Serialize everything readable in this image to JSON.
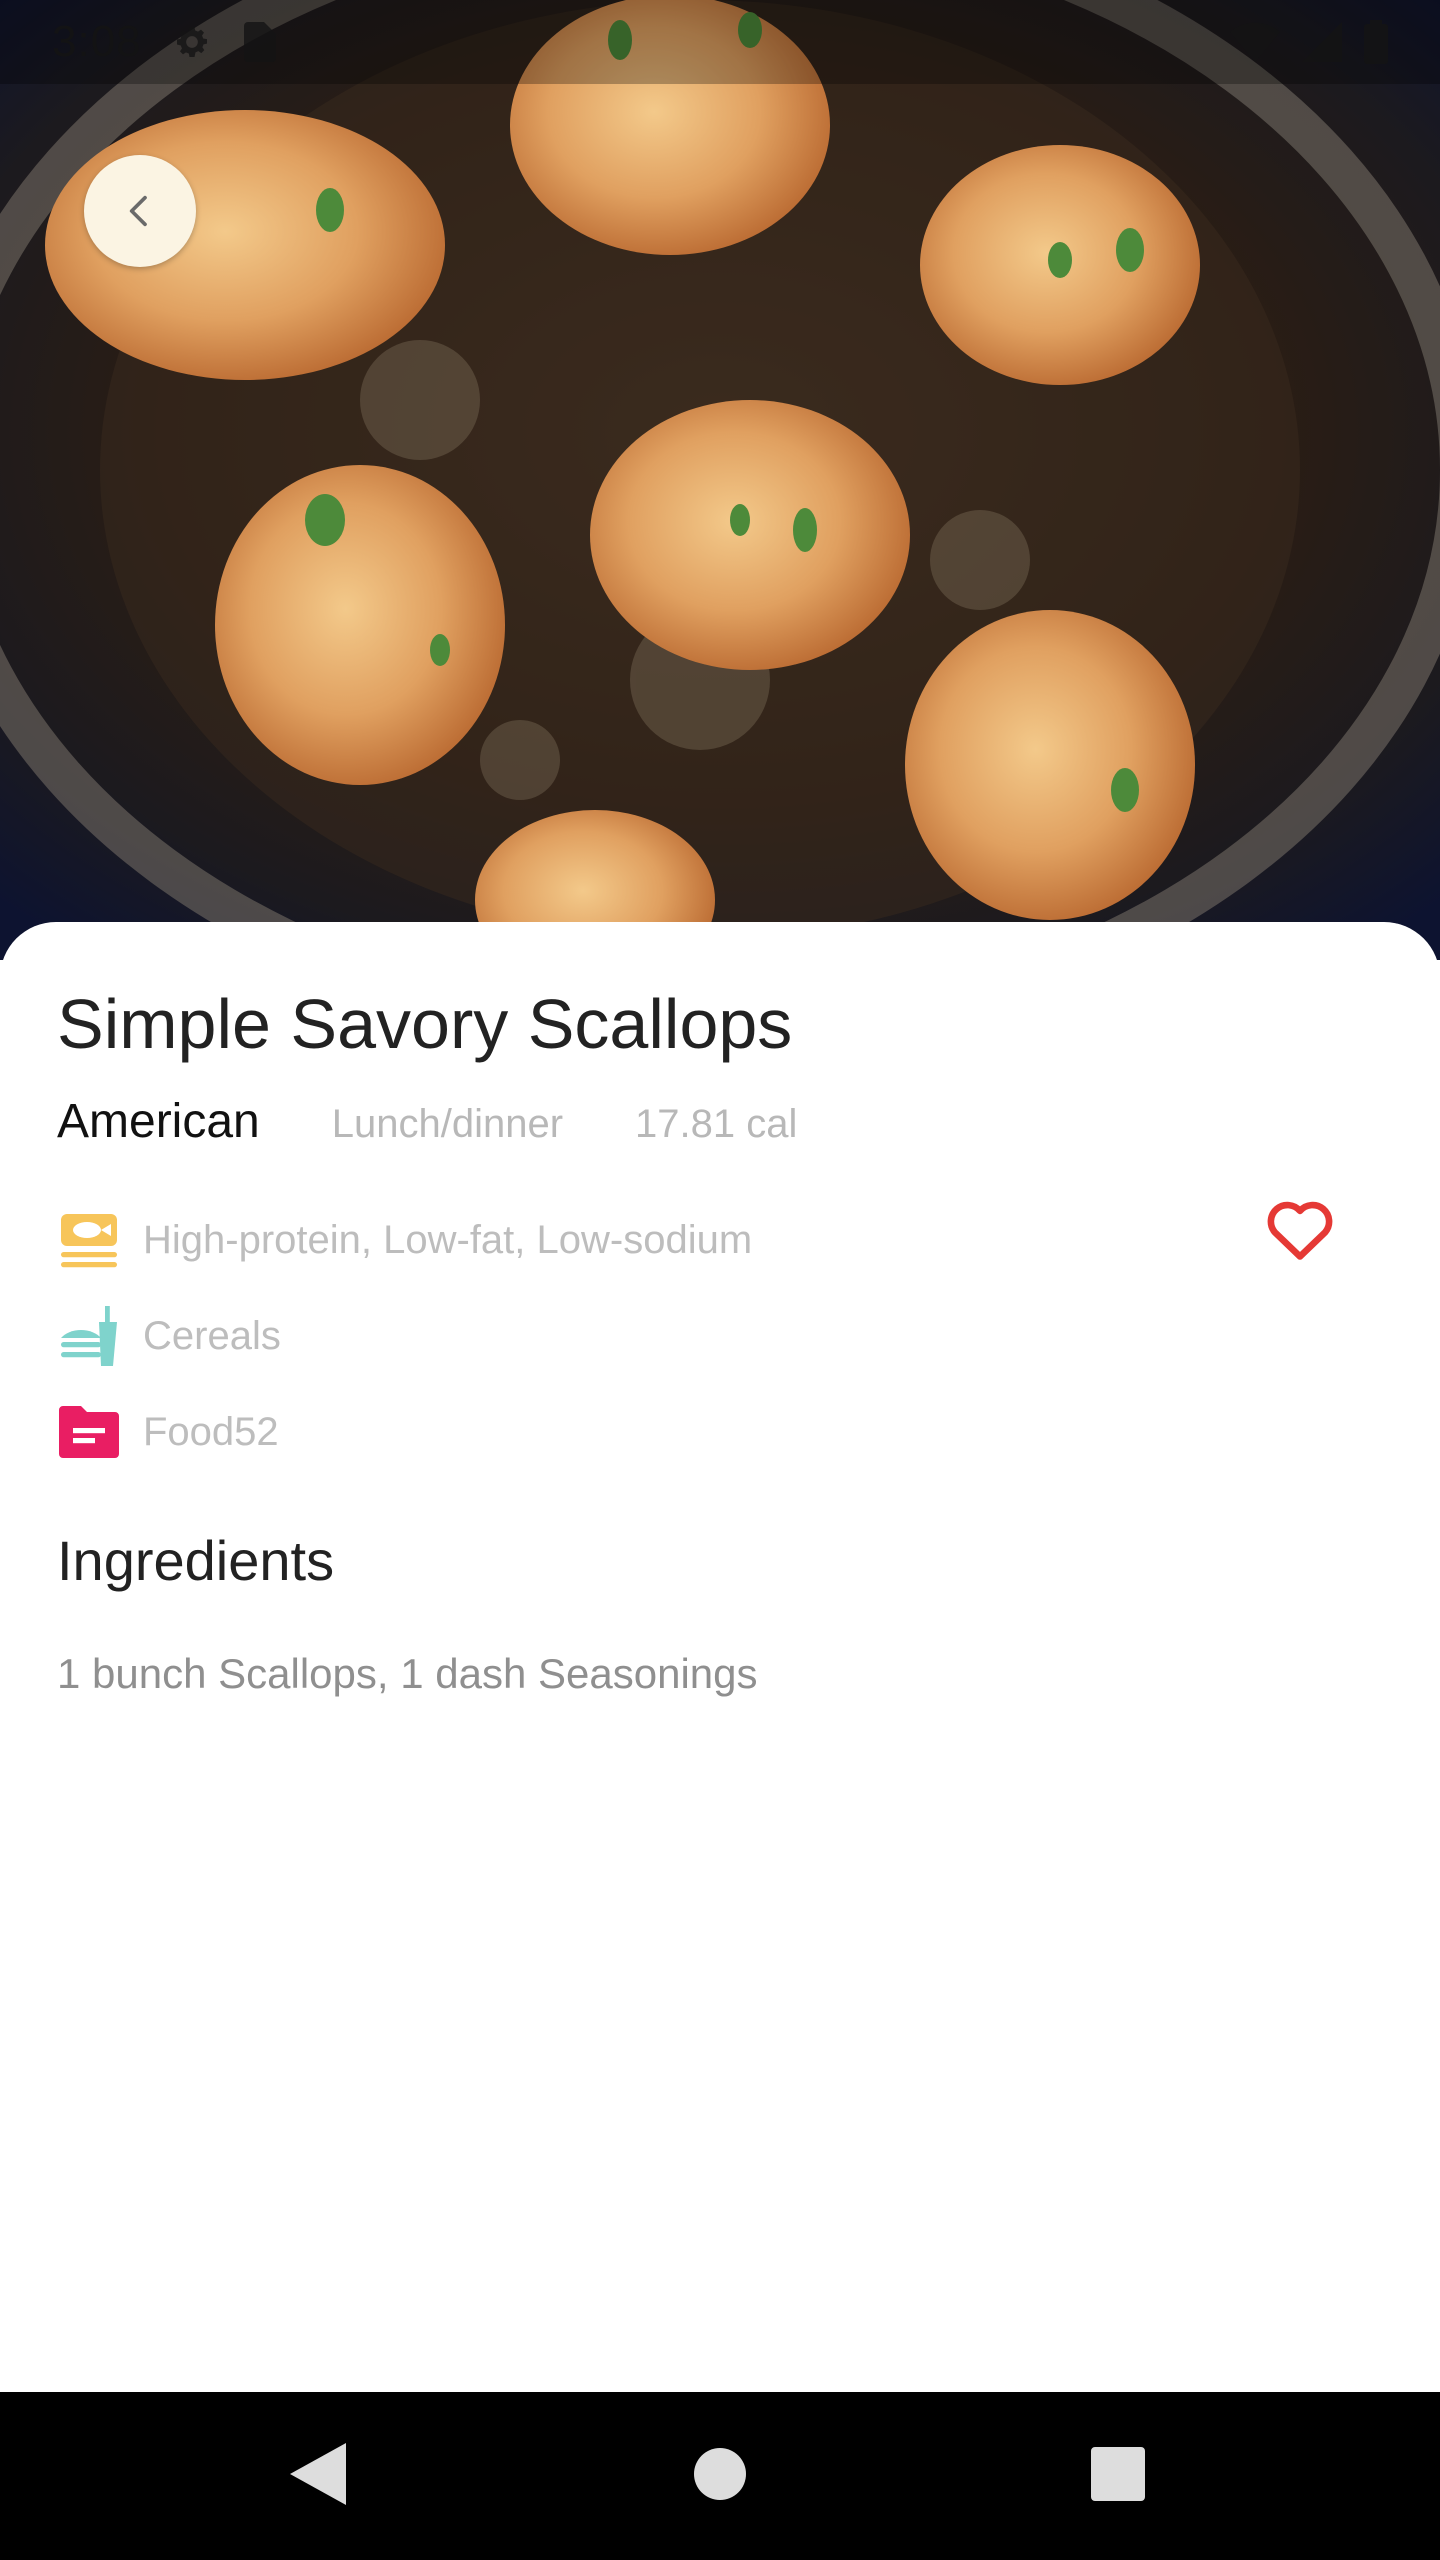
{
  "status_bar": {
    "time": "3:08",
    "icons": [
      "gear-icon",
      "sim-card-icon",
      "wifi-icon",
      "signal-icon",
      "battery-icon"
    ]
  },
  "hero": {
    "image": "pan-seared-scallops-photo",
    "back_icon": "chevron-left-icon"
  },
  "recipe": {
    "title": "Simple Savory Scallops",
    "cuisine": "American",
    "meal_type": "Lunch/dinner",
    "calories": "17.81 cal",
    "health_labels": "High-protein, Low-fat, Low-sodium",
    "dish_type": "Cereals",
    "source": "Food52",
    "favorite_icon": "heart-outline-icon"
  },
  "ingredients": {
    "heading": "Ingredients",
    "text": "1 bunch Scallops, 1 dash Seasonings"
  },
  "colors": {
    "back_button_bg": "#fbf4e3",
    "heart": "#e53935",
    "health_icon": "#f7c55a",
    "dish_icon": "#7fd3cc",
    "source_icon": "#e91e63"
  },
  "nav_bar": {
    "back_icon": "triangle-back-icon",
    "home_icon": "circle-home-icon",
    "recent_icon": "square-recents-icon"
  }
}
